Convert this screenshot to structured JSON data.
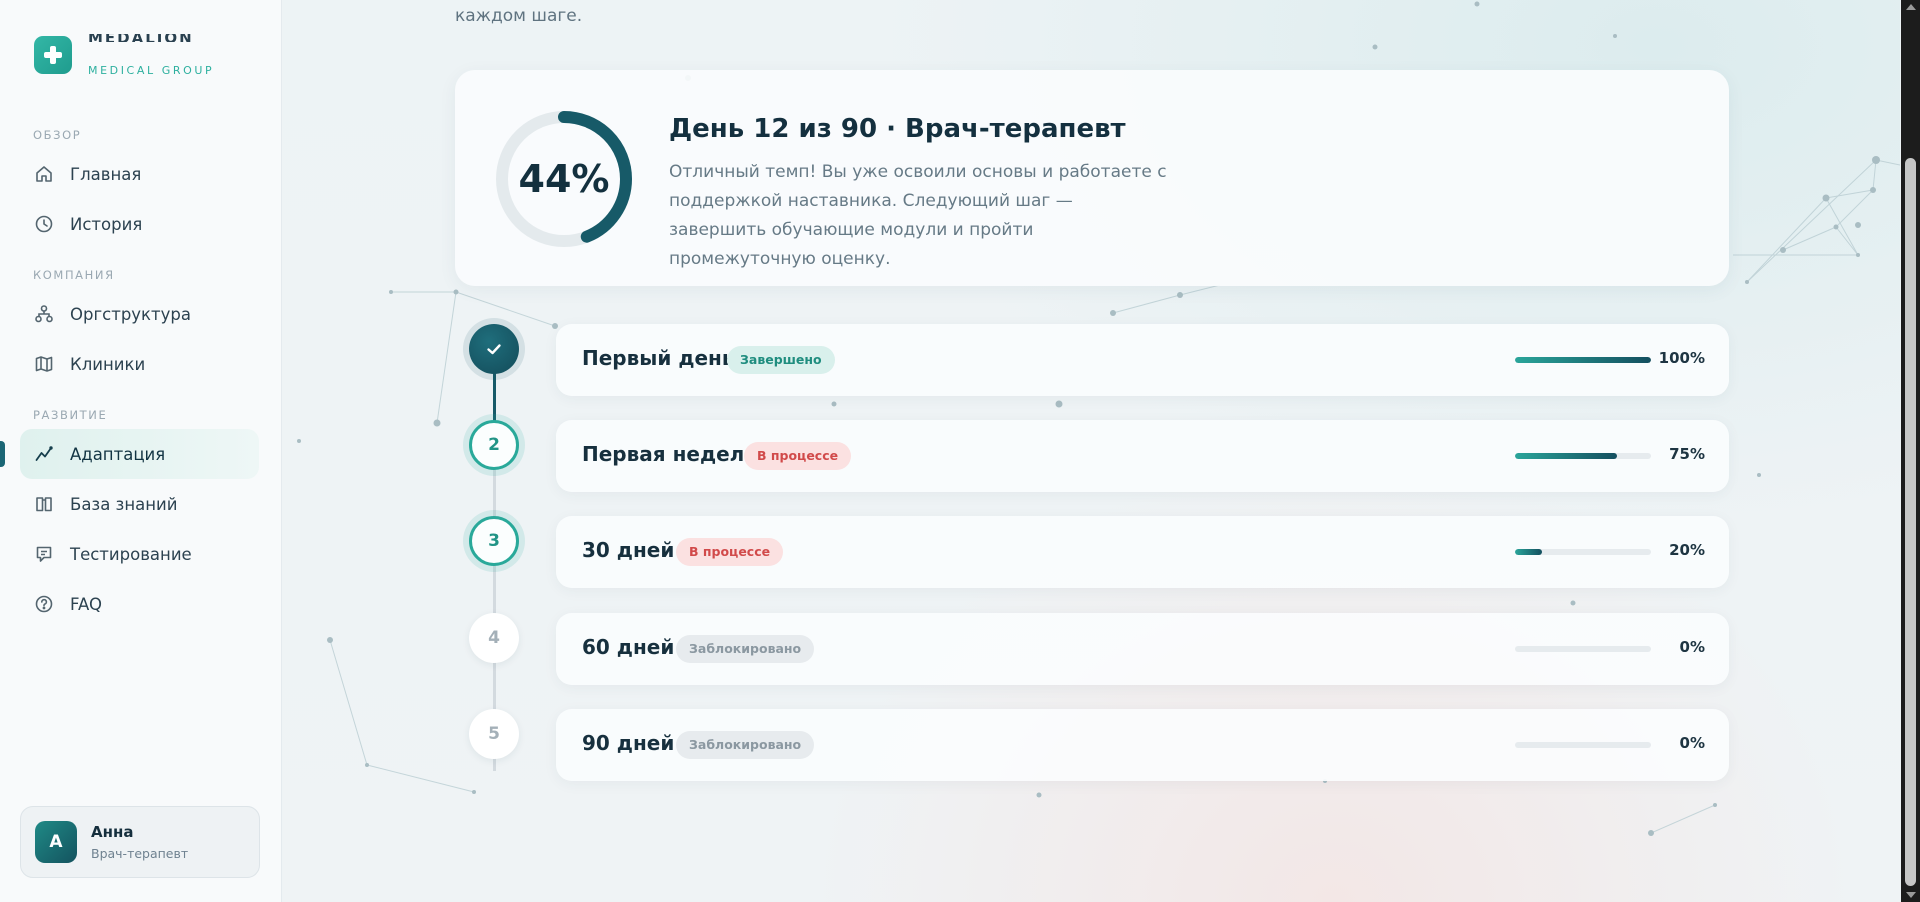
{
  "brand": {
    "name": "MEDALION",
    "subtitle": "MEDICAL GROUP",
    "accent": "#2eb09f"
  },
  "sidebar": {
    "sections": [
      {
        "label": "ОБЗОР"
      },
      {
        "label": "КОМПАНИЯ"
      },
      {
        "label": "РАЗВИТИЕ"
      }
    ],
    "items": [
      {
        "label": "Главная",
        "icon": "home-icon"
      },
      {
        "label": "История",
        "icon": "clock-icon"
      },
      {
        "label": "Оргструктура",
        "icon": "org-structure-icon"
      },
      {
        "label": "Клиники",
        "icon": "map-icon"
      },
      {
        "label": "Адаптация",
        "icon": "trend-icon",
        "active": true
      },
      {
        "label": "База знаний",
        "icon": "book-icon"
      },
      {
        "label": "Тестирование",
        "icon": "test-icon"
      },
      {
        "label": "FAQ",
        "icon": "help-icon"
      }
    ]
  },
  "user": {
    "initial": "A",
    "name": "Анна",
    "role": "Врач-терапевт"
  },
  "intro": "каждом шаге.",
  "progress": {
    "percent_label": "44%",
    "percent": 44,
    "title": "День 12 из 90 · Врач-терапевт",
    "description": "Отличный темп! Вы уже освоили основы и работаете с поддержкой наставника. Следующий шаг — завершить обучающие модули и пройти промежуточную оценку."
  },
  "stages": [
    {
      "step": "1",
      "title": "Первый день",
      "status": "Завершено",
      "status_type": "done",
      "progress": 100,
      "progress_label": "100%"
    },
    {
      "step": "2",
      "title": "Первая неделя",
      "status": "В процессе",
      "status_type": "progress",
      "progress": 75,
      "progress_label": "75%"
    },
    {
      "step": "3",
      "title": "30 дней",
      "status": "В процессе",
      "status_type": "progress",
      "progress": 20,
      "progress_label": "20%"
    },
    {
      "step": "4",
      "title": "60 дней",
      "status": "Заблокировано",
      "status_type": "locked",
      "progress": 0,
      "progress_label": "0%"
    },
    {
      "step": "5",
      "title": "90 дней",
      "status": "Заблокировано",
      "status_type": "locked",
      "progress": 0,
      "progress_label": "0%"
    }
  ],
  "colors": {
    "primary_dark": "#134b59",
    "teal": "#29a99a",
    "in_progress": "#d14a4a"
  }
}
